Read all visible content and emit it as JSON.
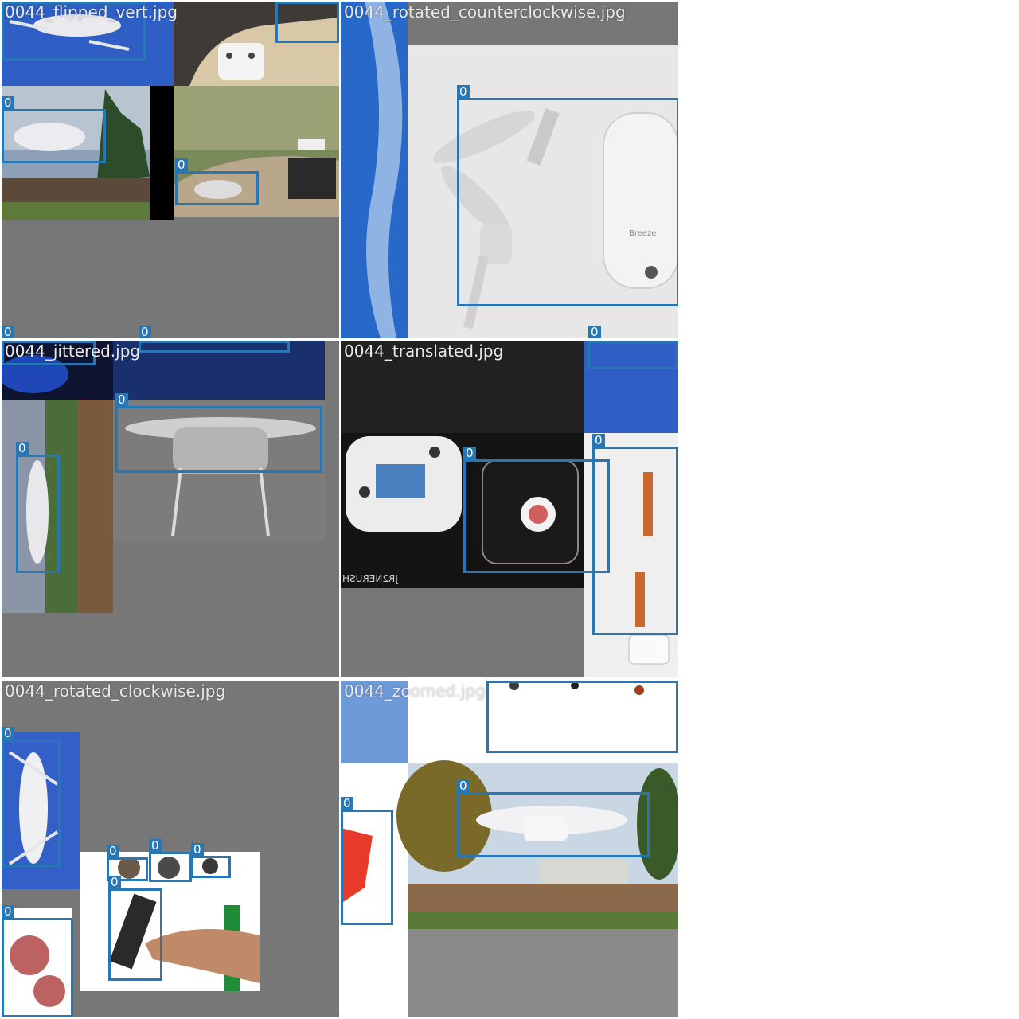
{
  "mosaic": {
    "background": "#ffffff",
    "tile_fill": "#777777",
    "box_color": "#2677b4",
    "title_color": "#e9e9e9",
    "tiles": [
      {
        "name": "0044_flipped_vert.jpg",
        "title": "0044_flipped_vert.jpg",
        "class_label": "0"
      },
      {
        "name": "0044_rotated_counterclockwise.jpg",
        "title": "0044_rotated_counterclockwise.jpg",
        "class_label": "0"
      },
      {
        "name": "0044_jittered.jpg",
        "title": "0044_jittered.jpg",
        "class_label": "0"
      },
      {
        "name": "0044_translated.jpg",
        "title": "0044_translated.jpg",
        "class_label": "0"
      },
      {
        "name": "0044_rotated_clockwise.jpg",
        "title": "0044_rotated_clockwise.jpg",
        "class_label": "0"
      },
      {
        "name": "0044_zoomed.jpg",
        "title": "0044_zoomed.jpg",
        "class_label": "0"
      }
    ],
    "photo_text": {
      "brand_mark": "Breeze",
      "controller_mark": "JR2NERUSH"
    }
  }
}
